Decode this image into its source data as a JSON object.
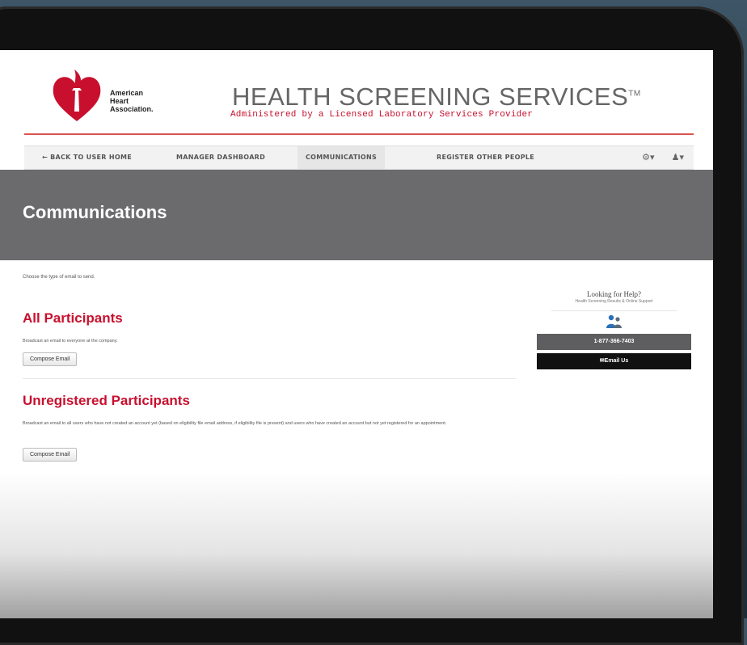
{
  "brand": {
    "logo_lines": [
      "American",
      "Heart",
      "Association."
    ],
    "title": "HEALTH SCREENING SERVICES",
    "trademark": "TM",
    "subtitle": "Administered by a Licensed Laboratory Services Provider",
    "accent_color": "#c8102e"
  },
  "nav": {
    "items": [
      {
        "label": "← BACK TO USER HOME"
      },
      {
        "label": "MANAGER DASHBOARD"
      },
      {
        "label": "COMMUNICATIONS",
        "active": true
      },
      {
        "label": "REGISTER OTHER PEOPLE"
      }
    ],
    "settings_icon": "gear-icon",
    "settings_glyph": "⚙▾",
    "user_icon": "user-icon",
    "user_glyph": "♟▾"
  },
  "page": {
    "title": "Communications",
    "intro": "Choose the type of email to send."
  },
  "sections": [
    {
      "title": "All Participants",
      "description": "Broadcast an email to everyone at the company.",
      "button_label": "Compose Email"
    },
    {
      "title": "Unregistered Participants",
      "description": "Broadcast an email to all users who have not created an account yet (based on eligibility file email address, if eligibility file is present) and users who have created an account but not yet registered for an appointment.",
      "button_label": "Compose Email"
    }
  ],
  "help": {
    "title": "Looking for Help?",
    "subtitle": "Health Screening Results & Online Support",
    "icon": "people-icon",
    "phone": "1-877-366-7403",
    "email_label": "✉Email Us"
  }
}
